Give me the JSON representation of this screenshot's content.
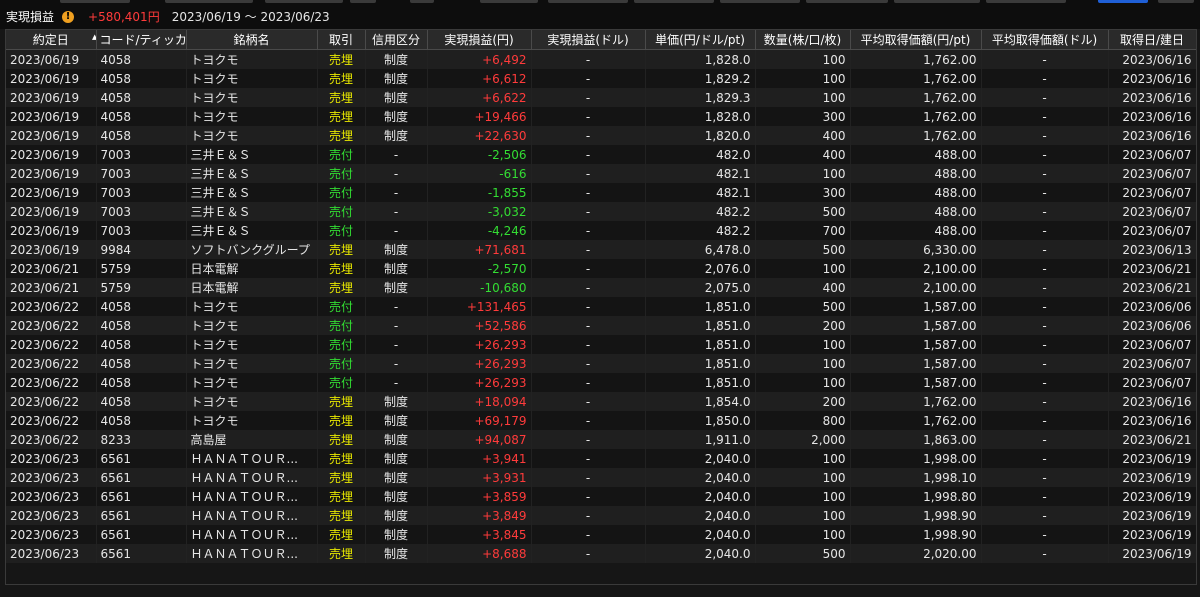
{
  "header": {
    "title": "実現損益",
    "warning_icon": "warning-icon",
    "total_pl": "+580,401円",
    "date_range": "2023/06/19 ～ 2023/06/23"
  },
  "colors": {
    "positive": "#ff3b3b",
    "negative": "#33dd33",
    "sell_close": "#e8e800",
    "sell_open": "#33dd33"
  },
  "table": {
    "columns": [
      "約定日",
      "コード/ティッカー",
      "銘柄名",
      "取引",
      "信用区分",
      "実現損益(円)",
      "実現損益(ドル)",
      "単価(円/ドル/pt)",
      "数量(株/口/枚)",
      "平均取得価額(円/pt)",
      "平均取得価額(ドル)",
      "取得日/建日"
    ],
    "rows": [
      {
        "date": "2023/06/19",
        "code": "4058",
        "name": "トヨクモ",
        "trade": "売埋",
        "margin": "制度",
        "pl": "+6,492",
        "usd": "-",
        "price": "1,828.0",
        "qty": "100",
        "avg": "1,762.00",
        "avgusd": "-",
        "acq": "2023/06/16"
      },
      {
        "date": "2023/06/19",
        "code": "4058",
        "name": "トヨクモ",
        "trade": "売埋",
        "margin": "制度",
        "pl": "+6,612",
        "usd": "-",
        "price": "1,829.2",
        "qty": "100",
        "avg": "1,762.00",
        "avgusd": "-",
        "acq": "2023/06/16"
      },
      {
        "date": "2023/06/19",
        "code": "4058",
        "name": "トヨクモ",
        "trade": "売埋",
        "margin": "制度",
        "pl": "+6,622",
        "usd": "-",
        "price": "1,829.3",
        "qty": "100",
        "avg": "1,762.00",
        "avgusd": "-",
        "acq": "2023/06/16"
      },
      {
        "date": "2023/06/19",
        "code": "4058",
        "name": "トヨクモ",
        "trade": "売埋",
        "margin": "制度",
        "pl": "+19,466",
        "usd": "-",
        "price": "1,828.0",
        "qty": "300",
        "avg": "1,762.00",
        "avgusd": "-",
        "acq": "2023/06/16"
      },
      {
        "date": "2023/06/19",
        "code": "4058",
        "name": "トヨクモ",
        "trade": "売埋",
        "margin": "制度",
        "pl": "+22,630",
        "usd": "-",
        "price": "1,820.0",
        "qty": "400",
        "avg": "1,762.00",
        "avgusd": "-",
        "acq": "2023/06/16"
      },
      {
        "date": "2023/06/19",
        "code": "7003",
        "name": "三井Ｅ＆Ｓ",
        "trade": "売付",
        "margin": "-",
        "pl": "-2,506",
        "usd": "-",
        "price": "482.0",
        "qty": "400",
        "avg": "488.00",
        "avgusd": "-",
        "acq": "2023/06/07"
      },
      {
        "date": "2023/06/19",
        "code": "7003",
        "name": "三井Ｅ＆Ｓ",
        "trade": "売付",
        "margin": "-",
        "pl": "-616",
        "usd": "-",
        "price": "482.1",
        "qty": "100",
        "avg": "488.00",
        "avgusd": "-",
        "acq": "2023/06/07"
      },
      {
        "date": "2023/06/19",
        "code": "7003",
        "name": "三井Ｅ＆Ｓ",
        "trade": "売付",
        "margin": "-",
        "pl": "-1,855",
        "usd": "-",
        "price": "482.1",
        "qty": "300",
        "avg": "488.00",
        "avgusd": "-",
        "acq": "2023/06/07"
      },
      {
        "date": "2023/06/19",
        "code": "7003",
        "name": "三井Ｅ＆Ｓ",
        "trade": "売付",
        "margin": "-",
        "pl": "-3,032",
        "usd": "-",
        "price": "482.2",
        "qty": "500",
        "avg": "488.00",
        "avgusd": "-",
        "acq": "2023/06/07"
      },
      {
        "date": "2023/06/19",
        "code": "7003",
        "name": "三井Ｅ＆Ｓ",
        "trade": "売付",
        "margin": "-",
        "pl": "-4,246",
        "usd": "-",
        "price": "482.2",
        "qty": "700",
        "avg": "488.00",
        "avgusd": "-",
        "acq": "2023/06/07"
      },
      {
        "date": "2023/06/19",
        "code": "9984",
        "name": "ソフトバンクグループ",
        "trade": "売埋",
        "margin": "制度",
        "pl": "+71,681",
        "usd": "-",
        "price": "6,478.0",
        "qty": "500",
        "avg": "6,330.00",
        "avgusd": "-",
        "acq": "2023/06/13"
      },
      {
        "date": "2023/06/21",
        "code": "5759",
        "name": "日本電解",
        "trade": "売埋",
        "margin": "制度",
        "pl": "-2,570",
        "usd": "-",
        "price": "2,076.0",
        "qty": "100",
        "avg": "2,100.00",
        "avgusd": "-",
        "acq": "2023/06/21"
      },
      {
        "date": "2023/06/21",
        "code": "5759",
        "name": "日本電解",
        "trade": "売埋",
        "margin": "制度",
        "pl": "-10,680",
        "usd": "-",
        "price": "2,075.0",
        "qty": "400",
        "avg": "2,100.00",
        "avgusd": "-",
        "acq": "2023/06/21"
      },
      {
        "date": "2023/06/22",
        "code": "4058",
        "name": "トヨクモ",
        "trade": "売付",
        "margin": "-",
        "pl": "+131,465",
        "usd": "-",
        "price": "1,851.0",
        "qty": "500",
        "avg": "1,587.00",
        "avgusd": "-",
        "acq": "2023/06/06"
      },
      {
        "date": "2023/06/22",
        "code": "4058",
        "name": "トヨクモ",
        "trade": "売付",
        "margin": "-",
        "pl": "+52,586",
        "usd": "-",
        "price": "1,851.0",
        "qty": "200",
        "avg": "1,587.00",
        "avgusd": "-",
        "acq": "2023/06/06"
      },
      {
        "date": "2023/06/22",
        "code": "4058",
        "name": "トヨクモ",
        "trade": "売付",
        "margin": "-",
        "pl": "+26,293",
        "usd": "-",
        "price": "1,851.0",
        "qty": "100",
        "avg": "1,587.00",
        "avgusd": "-",
        "acq": "2023/06/07"
      },
      {
        "date": "2023/06/22",
        "code": "4058",
        "name": "トヨクモ",
        "trade": "売付",
        "margin": "-",
        "pl": "+26,293",
        "usd": "-",
        "price": "1,851.0",
        "qty": "100",
        "avg": "1,587.00",
        "avgusd": "-",
        "acq": "2023/06/07"
      },
      {
        "date": "2023/06/22",
        "code": "4058",
        "name": "トヨクモ",
        "trade": "売付",
        "margin": "-",
        "pl": "+26,293",
        "usd": "-",
        "price": "1,851.0",
        "qty": "100",
        "avg": "1,587.00",
        "avgusd": "-",
        "acq": "2023/06/07"
      },
      {
        "date": "2023/06/22",
        "code": "4058",
        "name": "トヨクモ",
        "trade": "売埋",
        "margin": "制度",
        "pl": "+18,094",
        "usd": "-",
        "price": "1,854.0",
        "qty": "200",
        "avg": "1,762.00",
        "avgusd": "-",
        "acq": "2023/06/16"
      },
      {
        "date": "2023/06/22",
        "code": "4058",
        "name": "トヨクモ",
        "trade": "売埋",
        "margin": "制度",
        "pl": "+69,179",
        "usd": "-",
        "price": "1,850.0",
        "qty": "800",
        "avg": "1,762.00",
        "avgusd": "-",
        "acq": "2023/06/16"
      },
      {
        "date": "2023/06/22",
        "code": "8233",
        "name": "高島屋",
        "trade": "売埋",
        "margin": "制度",
        "pl": "+94,087",
        "usd": "-",
        "price": "1,911.0",
        "qty": "2,000",
        "avg": "1,863.00",
        "avgusd": "-",
        "acq": "2023/06/21"
      },
      {
        "date": "2023/06/23",
        "code": "6561",
        "name": "ＨＡＮＡＴＯＵＲ...",
        "trade": "売埋",
        "margin": "制度",
        "pl": "+3,941",
        "usd": "-",
        "price": "2,040.0",
        "qty": "100",
        "avg": "1,998.00",
        "avgusd": "-",
        "acq": "2023/06/19"
      },
      {
        "date": "2023/06/23",
        "code": "6561",
        "name": "ＨＡＮＡＴＯＵＲ...",
        "trade": "売埋",
        "margin": "制度",
        "pl": "+3,931",
        "usd": "-",
        "price": "2,040.0",
        "qty": "100",
        "avg": "1,998.10",
        "avgusd": "-",
        "acq": "2023/06/19"
      },
      {
        "date": "2023/06/23",
        "code": "6561",
        "name": "ＨＡＮＡＴＯＵＲ...",
        "trade": "売埋",
        "margin": "制度",
        "pl": "+3,859",
        "usd": "-",
        "price": "2,040.0",
        "qty": "100",
        "avg": "1,998.80",
        "avgusd": "-",
        "acq": "2023/06/19"
      },
      {
        "date": "2023/06/23",
        "code": "6561",
        "name": "ＨＡＮＡＴＯＵＲ...",
        "trade": "売埋",
        "margin": "制度",
        "pl": "+3,849",
        "usd": "-",
        "price": "2,040.0",
        "qty": "100",
        "avg": "1,998.90",
        "avgusd": "-",
        "acq": "2023/06/19"
      },
      {
        "date": "2023/06/23",
        "code": "6561",
        "name": "ＨＡＮＡＴＯＵＲ...",
        "trade": "売埋",
        "margin": "制度",
        "pl": "+3,845",
        "usd": "-",
        "price": "2,040.0",
        "qty": "100",
        "avg": "1,998.90",
        "avgusd": "-",
        "acq": "2023/06/19"
      },
      {
        "date": "2023/06/23",
        "code": "6561",
        "name": "ＨＡＮＡＴＯＵＲ...",
        "trade": "売埋",
        "margin": "制度",
        "pl": "+8,688",
        "usd": "-",
        "price": "2,040.0",
        "qty": "500",
        "avg": "2,020.00",
        "avgusd": "-",
        "acq": "2023/06/19"
      }
    ]
  }
}
